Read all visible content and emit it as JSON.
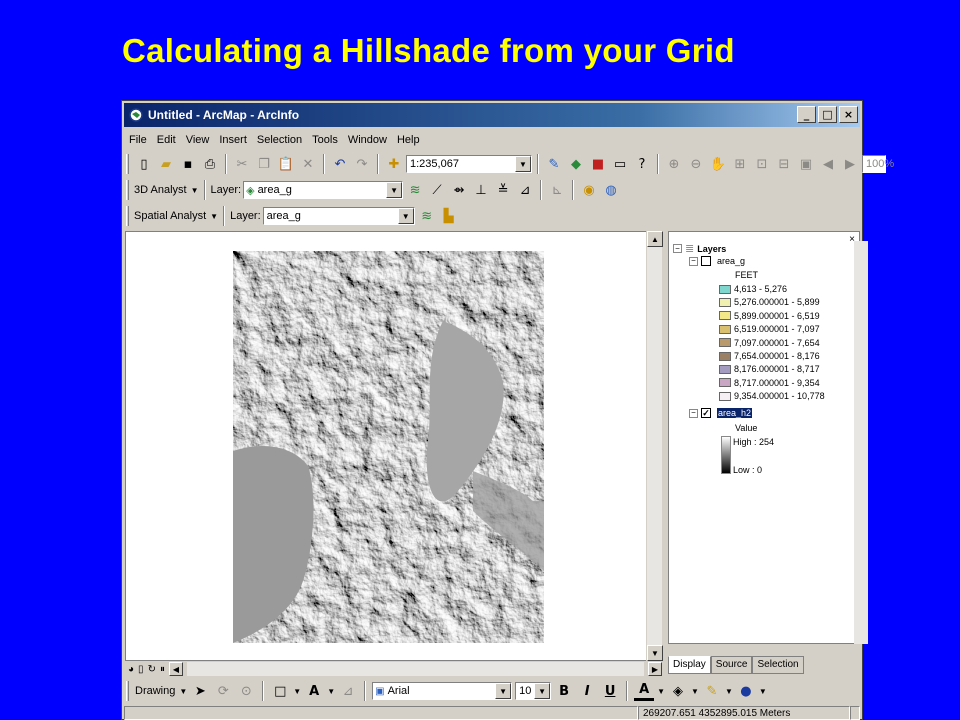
{
  "slide": {
    "title": "Calculating a Hillshade from your Grid"
  },
  "window": {
    "title": "Untitled - ArcMap - ArcInfo",
    "controls": [
      "_",
      "□",
      "×"
    ]
  },
  "menu": [
    "File",
    "Edit",
    "View",
    "Insert",
    "Selection",
    "Tools",
    "Window",
    "Help"
  ],
  "standard_toolbar": {
    "scale": "1:235,067",
    "zoom": "100%"
  },
  "analyst_3d": {
    "label": "3D Analyst",
    "layer_label": "Layer:",
    "layer_value": "area_g"
  },
  "spatial_analyst": {
    "label": "Spatial Analyst",
    "layer_label": "Layer:",
    "layer_value": "area_g"
  },
  "toc": {
    "root": "Layers",
    "layer1": {
      "name": "area_g",
      "checked": false,
      "field": "FEET",
      "classes": [
        {
          "label": "4,613 - 5,276",
          "color": "#7fd6cf"
        },
        {
          "label": "5,276.000001 - 5,899",
          "color": "#f0f0b0"
        },
        {
          "label": "5,899.000001 - 6,519",
          "color": "#f2e88a"
        },
        {
          "label": "6,519.000001 - 7,097",
          "color": "#d9c070"
        },
        {
          "label": "7,097.000001 - 7,654",
          "color": "#b89a6c"
        },
        {
          "label": "7,654.000001 - 8,176",
          "color": "#9c8066"
        },
        {
          "label": "8,176.000001 - 8,717",
          "color": "#a49cc0"
        },
        {
          "label": "8,717.000001 - 9,354",
          "color": "#c8a6c4"
        },
        {
          "label": "9,354.000001 - 10,778",
          "color": "#f4f0f4"
        }
      ]
    },
    "layer2": {
      "name": "area_h2",
      "checked": true,
      "field": "Value",
      "high": "High : 254",
      "low": "Low : 0"
    },
    "tabs": [
      "Display",
      "Source",
      "Selection"
    ]
  },
  "drawing_toolbar": {
    "label": "Drawing",
    "font": "Arial",
    "size": "10",
    "bold": "B",
    "italic": "I",
    "underline": "U"
  },
  "status": {
    "coordinates": "269207.651  4352895.015 Meters"
  }
}
